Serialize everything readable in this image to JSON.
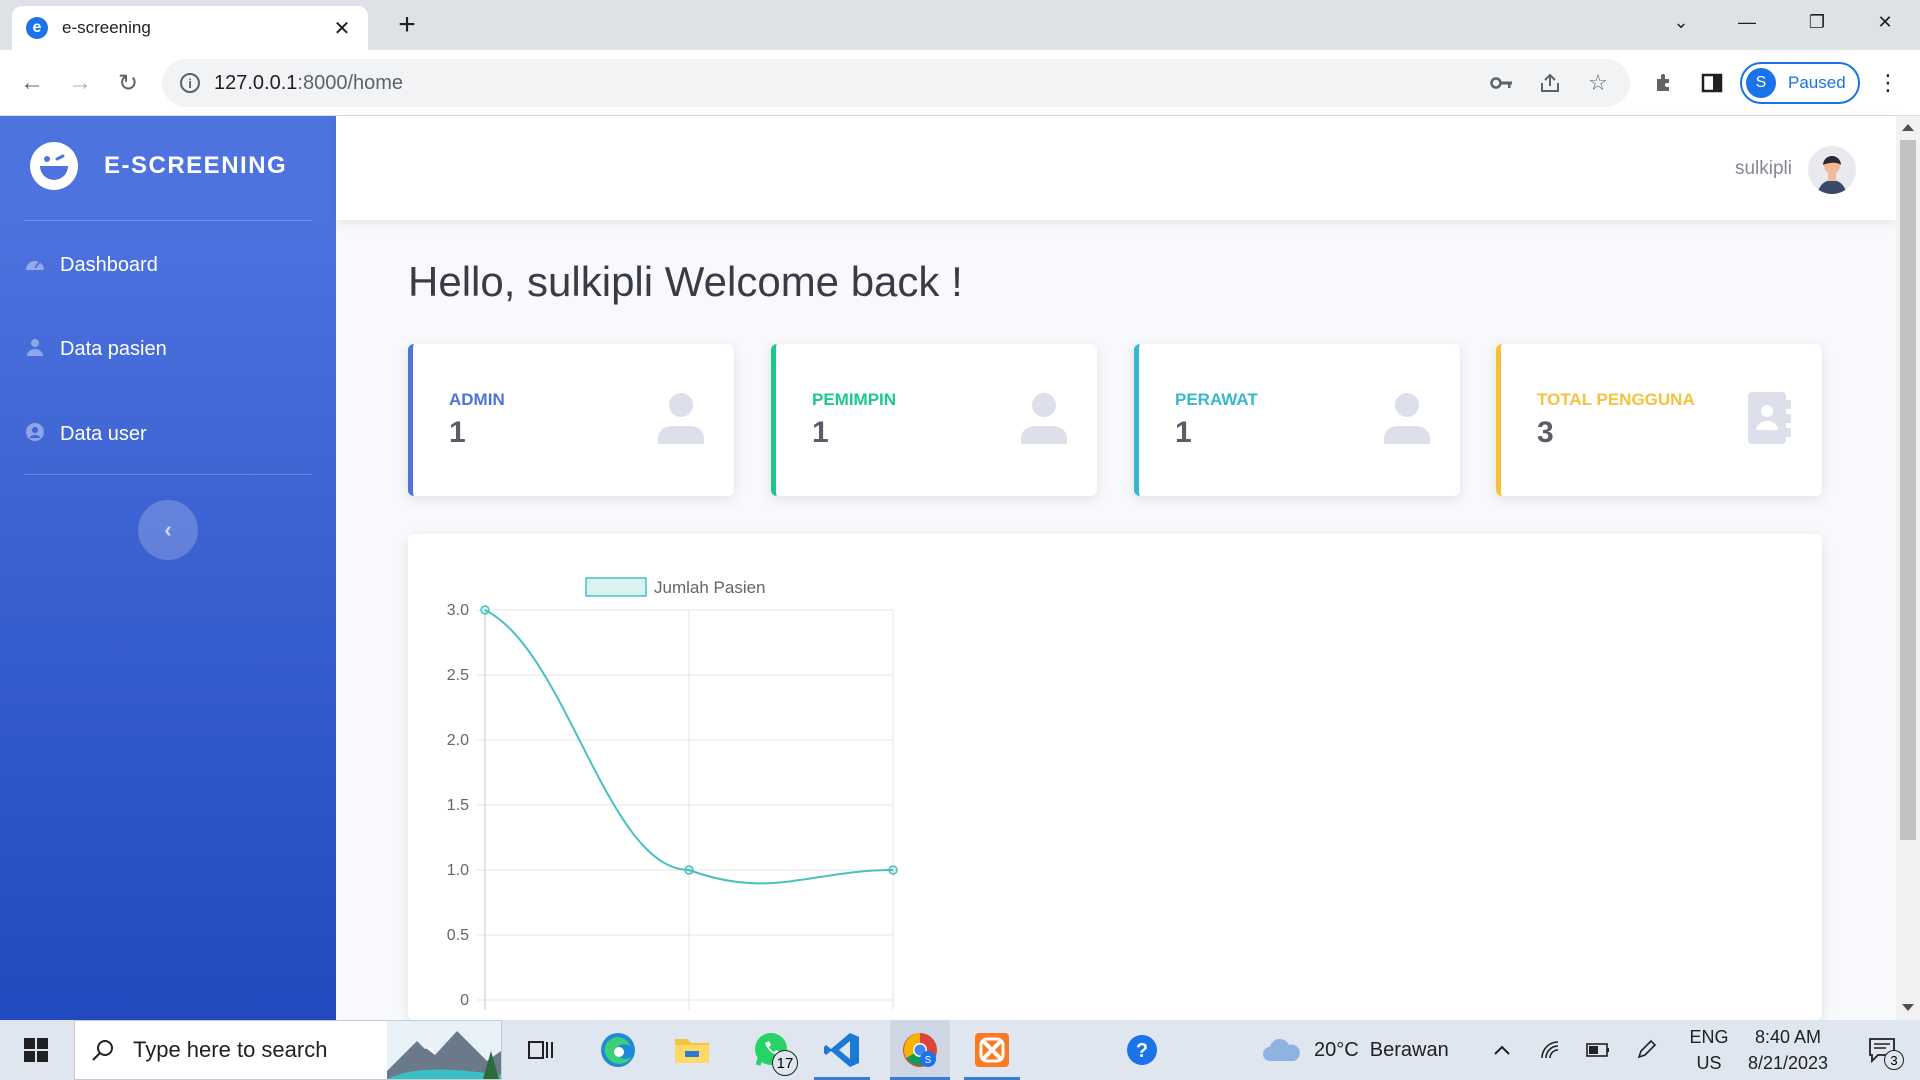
{
  "browser": {
    "tab_title": "e-screening",
    "url_host": "127.0.0.1",
    "url_path": ":8000/home",
    "profile_initial": "S",
    "profile_status": "Paused"
  },
  "sidebar": {
    "brand": "E-SCREENING",
    "items": [
      {
        "label": "Dashboard",
        "icon": "tachometer-icon"
      },
      {
        "label": "Data pasien",
        "icon": "user-icon"
      },
      {
        "label": "Data user",
        "icon": "user-circle-icon"
      }
    ],
    "toggle": "‹"
  },
  "topbar": {
    "username": "sulkipli"
  },
  "main": {
    "greeting": "Hello, sulkipli Welcome back !",
    "cards": [
      {
        "label": "ADMIN",
        "value": "1",
        "color": "#4e73df",
        "icon": "user-icon"
      },
      {
        "label": "PEMIMPIN",
        "value": "1",
        "color": "#1cc88a",
        "icon": "user-icon"
      },
      {
        "label": "PERAWAT",
        "value": "1",
        "color": "#36b9cc",
        "icon": "user-icon"
      },
      {
        "label": "TOTAL PENGGUNA",
        "value": "3",
        "color": "#f6c23e",
        "icon": "address-book-icon"
      }
    ]
  },
  "chart_data": {
    "type": "line",
    "series": [
      {
        "name": "Jumlah Pasien",
        "values": [
          3,
          1,
          1
        ]
      }
    ],
    "x": [
      "",
      "",
      ""
    ],
    "ylim": [
      0,
      3
    ],
    "yticks": [
      "3.0",
      "2.5",
      "2.0",
      "1.5",
      "1.0",
      "0.5",
      "0"
    ],
    "legend": "top",
    "grid": true,
    "color": "#4bc0c0"
  },
  "taskbar": {
    "search_placeholder": "Type here to search",
    "weather": "20°C  Berawan",
    "lang_top": "ENG",
    "lang_bottom": "US",
    "time": "8:40 AM",
    "date": "8/21/2023",
    "whatsapp_badge": "17",
    "notif_badge": "3"
  }
}
